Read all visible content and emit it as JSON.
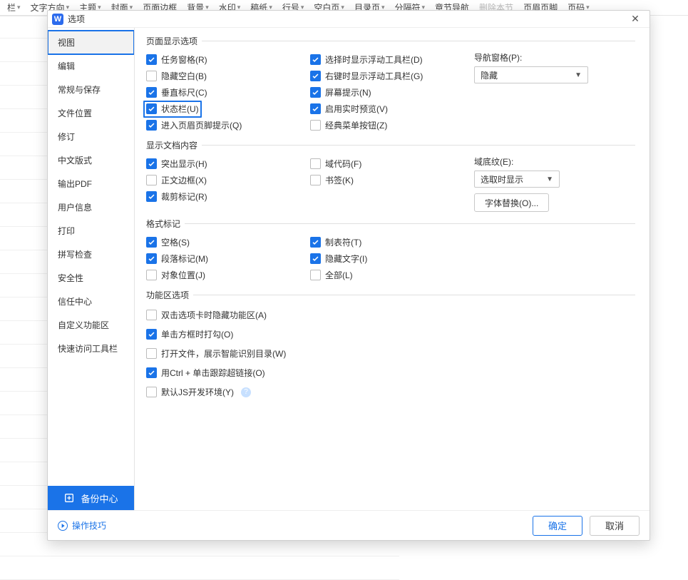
{
  "bg_menu": [
    {
      "label": "栏 ▾"
    },
    {
      "label": "文字方向 ▾"
    },
    {
      "label": "主题 ▾"
    },
    {
      "label": "封面 ▾"
    },
    {
      "label": "页面边框"
    },
    {
      "label": "背景 ▾"
    },
    {
      "label": "水印 ▾"
    },
    {
      "label": "稿纸 ▾"
    },
    {
      "label": "行号 ▾"
    },
    {
      "label": "空白页 ▾"
    },
    {
      "label": "目录页 ▾"
    },
    {
      "label": "分隔符 ▾"
    },
    {
      "label": "章节导航"
    },
    {
      "label": "删除本节",
      "disabled": true
    },
    {
      "label": "页眉页脚"
    },
    {
      "label": "页码 ▾"
    }
  ],
  "dialog": {
    "title": "选项",
    "close": "✕",
    "sidebar": {
      "items": [
        "视图",
        "编辑",
        "常规与保存",
        "文件位置",
        "修订",
        "中文版式",
        "输出PDF",
        "用户信息",
        "打印",
        "拼写检查",
        "安全性",
        "信任中心",
        "自定义功能区",
        "快速访问工具栏"
      ],
      "backup_label": "备份中心"
    },
    "groups": {
      "pageDisplay": {
        "title": "页面显示选项",
        "left": [
          {
            "label": "任务窗格(R)",
            "checked": true
          },
          {
            "label": "隐藏空白(B)",
            "checked": false
          },
          {
            "label": "垂直标尺(C)",
            "checked": true
          },
          {
            "label": "状态栏(U)",
            "checked": true,
            "hl": true
          },
          {
            "label": "进入页眉页脚提示(Q)",
            "checked": true
          }
        ],
        "mid": [
          {
            "label": "选择时显示浮动工具栏(D)",
            "checked": true
          },
          {
            "label": "右键时显示浮动工具栏(G)",
            "checked": true
          },
          {
            "label": "屏幕提示(N)",
            "checked": true
          },
          {
            "label": "启用实时预览(V)",
            "checked": true
          },
          {
            "label": "经典菜单按钮(Z)",
            "checked": false
          }
        ],
        "navLabel": "导航窗格(P):",
        "navValue": "隐藏"
      },
      "docContent": {
        "title": "显示文档内容",
        "left": [
          {
            "label": "突出显示(H)",
            "checked": true
          },
          {
            "label": "正文边框(X)",
            "checked": false
          },
          {
            "label": "裁剪标记(R)",
            "checked": true
          }
        ],
        "mid": [
          {
            "label": "域代码(F)",
            "checked": false
          },
          {
            "label": "书签(K)",
            "checked": false
          }
        ],
        "shadeLabel": "域底纹(E):",
        "shadeValue": "选取时显示",
        "fontSub": "字体替换(O)..."
      },
      "formatMarks": {
        "title": "格式标记",
        "left": [
          {
            "label": "空格(S)",
            "checked": true
          },
          {
            "label": "段落标记(M)",
            "checked": true
          },
          {
            "label": "对象位置(J)",
            "checked": false
          }
        ],
        "mid": [
          {
            "label": "制表符(T)",
            "checked": true
          },
          {
            "label": "隐藏文字(I)",
            "checked": true
          },
          {
            "label": "全部(L)",
            "checked": false
          }
        ]
      },
      "ribbon": {
        "title": "功能区选项",
        "items": [
          {
            "label": "双击选项卡时隐藏功能区(A)",
            "checked": false
          },
          {
            "label": "单击方框时打勾(O)",
            "checked": true
          },
          {
            "label": "打开文件，展示智能识别目录(W)",
            "checked": false
          },
          {
            "label": "用Ctrl + 单击跟踪超链接(O)",
            "checked": true
          },
          {
            "label": "默认JS开发环境(Y)",
            "checked": false,
            "help": true
          }
        ]
      }
    },
    "footer": {
      "tips": "操作技巧",
      "ok": "确定",
      "cancel": "取消"
    }
  }
}
